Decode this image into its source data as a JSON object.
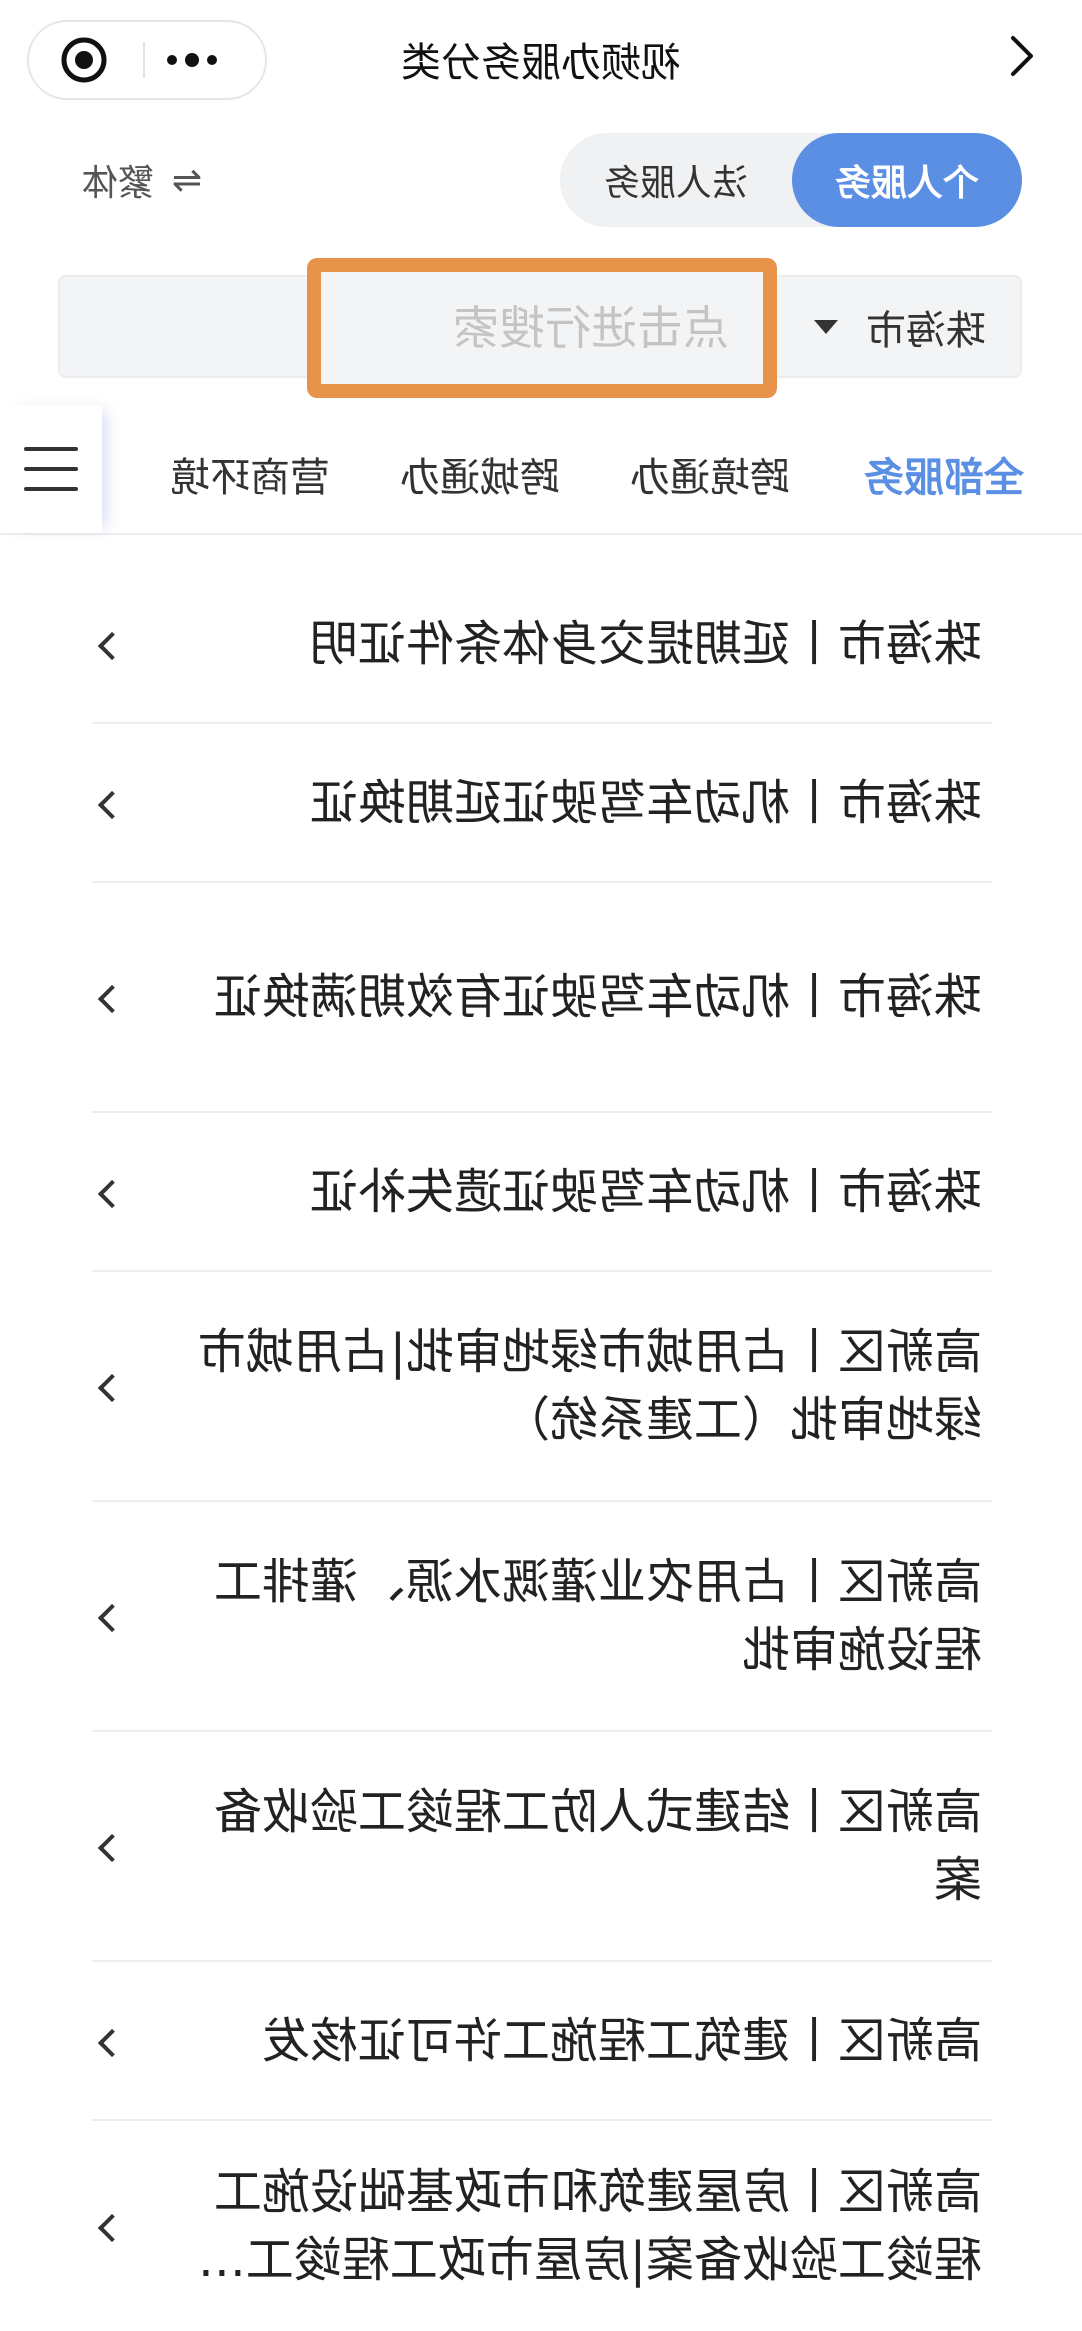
{
  "header": {
    "title": "视频办服务分类",
    "back_icon": "chevron-left-icon",
    "capsule": {
      "more_icon": "more-dots-icon",
      "close_icon": "target-close-icon"
    }
  },
  "segment": {
    "active_label": "个人服务",
    "inactive_label": "法人服务",
    "active_color": "#5b8fe3"
  },
  "lang_switch": {
    "label": "繁体",
    "icon": "swap-arrows-icon",
    "icon_glyph": "⇋"
  },
  "search": {
    "city": "珠海市",
    "placeholder": "点击进行搜索",
    "highlight_color": "#e8934a"
  },
  "tabs": {
    "items": [
      {
        "label": "全部服务"
      },
      {
        "label": "跨境通办"
      },
      {
        "label": "跨城通办"
      },
      {
        "label": "营商环境"
      }
    ],
    "menu_icon": "hamburger-menu-icon"
  },
  "list": {
    "items": [
      {
        "label": "珠海市丨延期提交身体条件证明"
      },
      {
        "label": "珠海市丨机动车驾驶证延期换证"
      },
      {
        "label": "珠海市丨机动车驾驶证有效期满换证"
      },
      {
        "label": "珠海市丨机动车驾驶证遗失补证"
      },
      {
        "label": "高新区丨占用城市绿地审批|占用城市绿地审批（工建系统）"
      },
      {
        "label": "高新区丨占用农业灌溉水源、灌排工程设施审批"
      },
      {
        "label": "高新区丨结建式人防工程竣工验收备案"
      },
      {
        "label": "高新区丨建筑工程施工许可证核发"
      },
      {
        "label": "高新区丨房屋建筑和市政基础设施工程竣工验收备案|房屋市政工程竣工验收备案"
      }
    ]
  }
}
